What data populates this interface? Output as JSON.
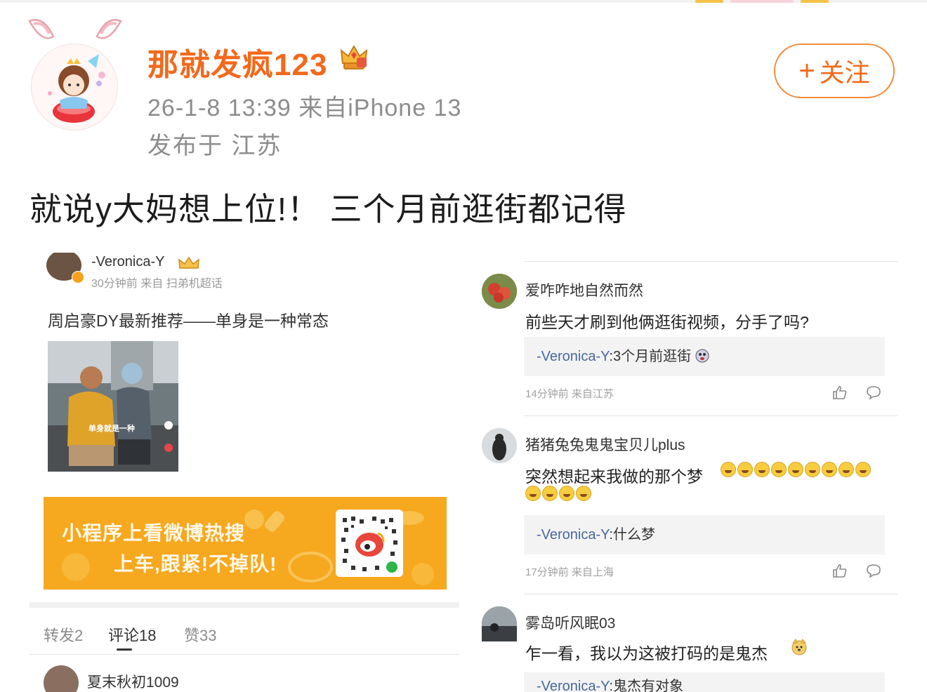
{
  "post": {
    "username": "那就发疯123",
    "meta_time": "26-1-8 13:39  来自iPhone 13",
    "meta_location": "发布于 江苏",
    "follow_label": "关注",
    "follow_plus": "+",
    "text": "就说y大妈想上位!！ 三个月前逛街都记得",
    "icons": {
      "crown": "crown-vip-icon",
      "avatar": "bunny-girl-avatar"
    }
  },
  "left_shot": {
    "author": "-Veronica-Y",
    "meta": "30分钟前 来自 扫弟机超话",
    "text": "周启豪DY最新推荐——单身是一种常态",
    "video_caption": "单身就是一种",
    "banner_line1": "小程序上看微博热搜",
    "banner_line2": "上车,跟紧!不掉队!",
    "tabs": [
      {
        "label": "转发2"
      },
      {
        "label": "评论18"
      },
      {
        "label": "赞33"
      }
    ],
    "comment_name": "夏末秋初1009"
  },
  "right_shot": {
    "comments": [
      {
        "name": "爱咋咋地自然而然",
        "text": "前些天才刷到他俩逛街视频，分手了吗?",
        "reply_name": "-Veronica-Y",
        "reply_text": ":3个月前逛街",
        "time": "14分钟前 来自江苏"
      },
      {
        "name": "猪猪兔兔鬼鬼宝贝儿plus",
        "text": "突然想起来我做的那个梦",
        "reply_name": "-Veronica-Y",
        "reply_text": ":什么梦",
        "time": "17分钟前 来自上海"
      },
      {
        "name": "雾岛听风眠03",
        "text": "乍一看，我以为这被打码的是鬼杰",
        "reply_name": "-Veronica-Y",
        "reply_text": ":鬼杰有对象"
      }
    ]
  },
  "colors": {
    "username": "#f2691c",
    "follow_border": "#f28c3b",
    "meta_gray": "#8d8d8d",
    "reply_name_blue": "#46689e",
    "banner_orange": "#f6a81f"
  }
}
